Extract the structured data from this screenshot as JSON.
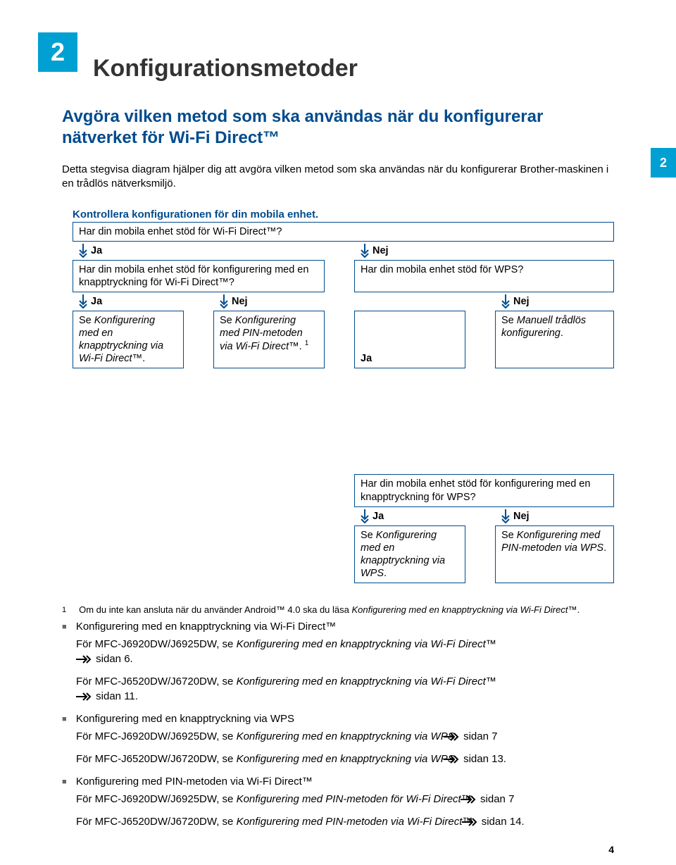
{
  "chapter_number": "2",
  "side_tab": "2",
  "page_number": "4",
  "title": "Konfigurationsmetoder",
  "subtitle": "Avgöra vilken metod som ska användas när du konfigurerar nätverket för Wi-Fi Direct™",
  "intro": "Detta stegvisa diagram hjälper dig att avgöra vilken metod som ska användas när du konfigurerar Brother-maskinen i en trådlös nätverksmiljö.",
  "flow": {
    "header": "Kontrollera konfigurationen för din mobila enhet.",
    "q1": "Har din mobila enhet stöd för Wi-Fi Direct™?",
    "yes": "Ja",
    "no": "Nej",
    "q2L": "Har din mobila enhet stöd för konfigurering med en knapptryckning för Wi-Fi Direct™?",
    "q2R": "Har din mobila enhet stöd för WPS?",
    "r3a_pre": "Se ",
    "r3a_it": "Konfigurering med en knapptryckning via Wi-Fi Direct™",
    "r3a_post": ".",
    "r3b_pre": "Se ",
    "r3b_it": "Konfigurering med PIN-metoden via Wi-Fi Direct™",
    "r3b_post": ". ",
    "r3b_sup": "1",
    "r3d_pre": "Se ",
    "r3d_it": "Manuell trådlös konfigurering",
    "r3d_post": ".",
    "q4": "Har din mobila enhet stöd för konfigurering med en knapptryckning för WPS?",
    "r5a_pre": "Se ",
    "r5a_it": "Konfigurering med en knapptryckning via WPS",
    "r5a_post": ".",
    "r5b_pre": "Se ",
    "r5b_it": "Konfigurering med PIN-metoden via WPS",
    "r5b_post": "."
  },
  "footnote": {
    "num": "1",
    "pre": "Om du inte kan ansluta när du använder Android™ 4.0 ska du läsa ",
    "it": "Konfigurering med en knapptryckning via Wi-Fi Direct™",
    "post": "."
  },
  "bullets": [
    {
      "head": "Konfigurering med en knapptryckning via Wi-Fi Direct™",
      "subs": [
        {
          "pre": "För MFC-J6920DW/J6925DW, se ",
          "it": "Konfigurering med en knapptryckning via Wi-Fi Direct™",
          "post1": "",
          "pg": " sidan 6."
        },
        {
          "pre": "För MFC-J6520DW/J6720DW, se ",
          "it": "Konfigurering med en knapptryckning via Wi-Fi Direct™",
          "post1": "",
          "pg": " sidan 11."
        }
      ]
    },
    {
      "head": "Konfigurering med en knapptryckning via WPS",
      "subs": [
        {
          "pre": "För MFC-J6920DW/J6925DW, se ",
          "it": "Konfigurering med en knapptryckning via WPS",
          "post1": " ",
          "pg": " sidan 7"
        },
        {
          "pre": "För MFC-J6520DW/J6720DW, se ",
          "it": "Konfigurering med en knapptryckning via WPS",
          "post1": " ",
          "pg": " sidan 13."
        }
      ]
    },
    {
      "head": "Konfigurering med PIN-metoden via Wi-Fi Direct™",
      "subs": [
        {
          "pre": "För MFC-J6920DW/J6925DW, se ",
          "it": "Konfigurering med PIN-metoden för Wi-Fi Direct™",
          "post1": " ",
          "pg": " sidan 7"
        },
        {
          "pre": "För MFC-J6520DW/J6720DW, se ",
          "it": "Konfigurering med PIN-metoden via Wi-Fi Direct™",
          "post1": " ",
          "pg": " sidan 14."
        }
      ]
    }
  ]
}
